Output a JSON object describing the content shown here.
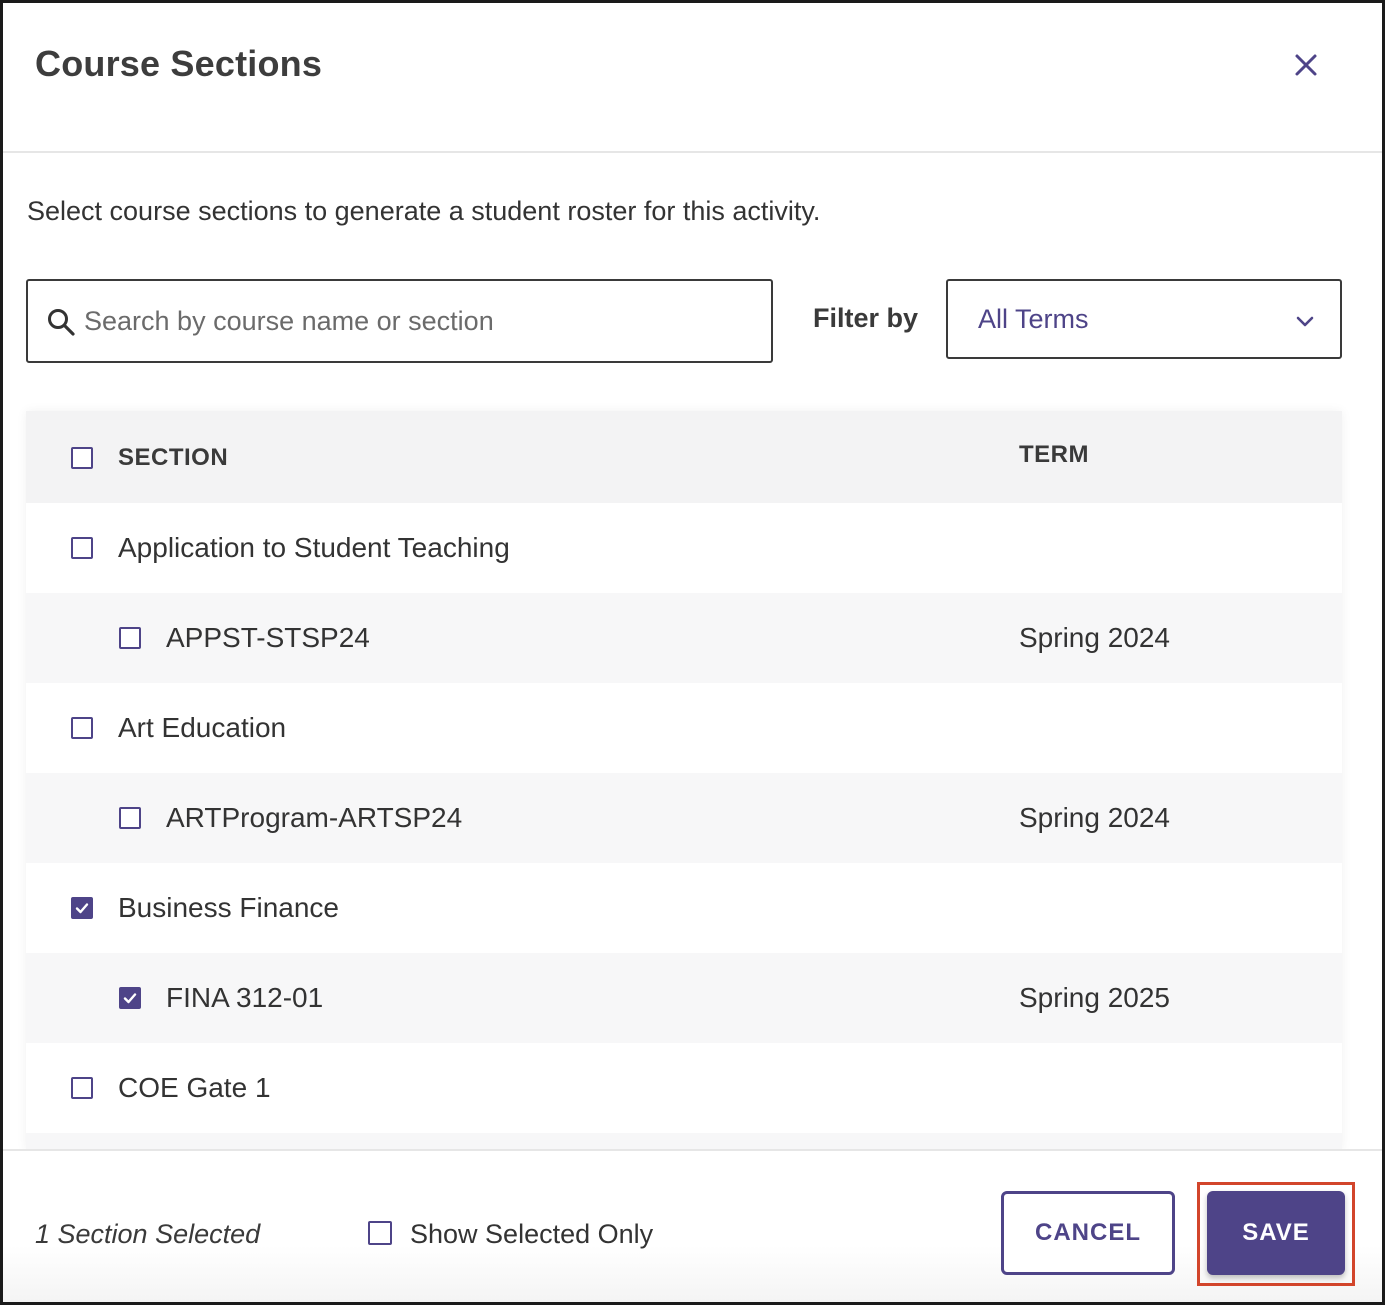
{
  "dialog": {
    "title": "Course Sections",
    "close_icon": "close-icon"
  },
  "intro_text": "Select course sections to generate a student roster for this activity.",
  "search": {
    "placeholder": "Search by course name or section",
    "value": "",
    "icon": "search-icon"
  },
  "filter": {
    "label": "Filter by",
    "selected": "All Terms",
    "icon": "chevron-down-icon"
  },
  "table": {
    "headers": {
      "section": "SECTION",
      "term": "TERM"
    },
    "select_all_checked": false,
    "rows": [
      {
        "type": "course",
        "label": "Application to Student Teaching",
        "term": "",
        "checked": false
      },
      {
        "type": "section",
        "label": "APPST-STSP24",
        "term": "Spring 2024",
        "checked": false
      },
      {
        "type": "course",
        "label": "Art Education",
        "term": "",
        "checked": false
      },
      {
        "type": "section",
        "label": "ARTProgram-ARTSP24",
        "term": "Spring 2024",
        "checked": false
      },
      {
        "type": "course",
        "label": "Business Finance",
        "term": "",
        "checked": true
      },
      {
        "type": "section",
        "label": "FINA 312-01",
        "term": "Spring 2025",
        "checked": true
      },
      {
        "type": "course",
        "label": "COE Gate 1",
        "term": "",
        "checked": false
      },
      {
        "type": "section",
        "label": "",
        "term": "",
        "checked": false
      }
    ]
  },
  "footer": {
    "selected_count": "1 Section Selected",
    "show_selected_label": "Show Selected Only",
    "show_selected_checked": false,
    "cancel_label": "CANCEL",
    "save_label": "SAVE"
  },
  "colors": {
    "accent": "#4e4488",
    "highlight": "#d2452b",
    "row_alt": "#f7f7f8",
    "header_bg": "#f3f3f4"
  }
}
